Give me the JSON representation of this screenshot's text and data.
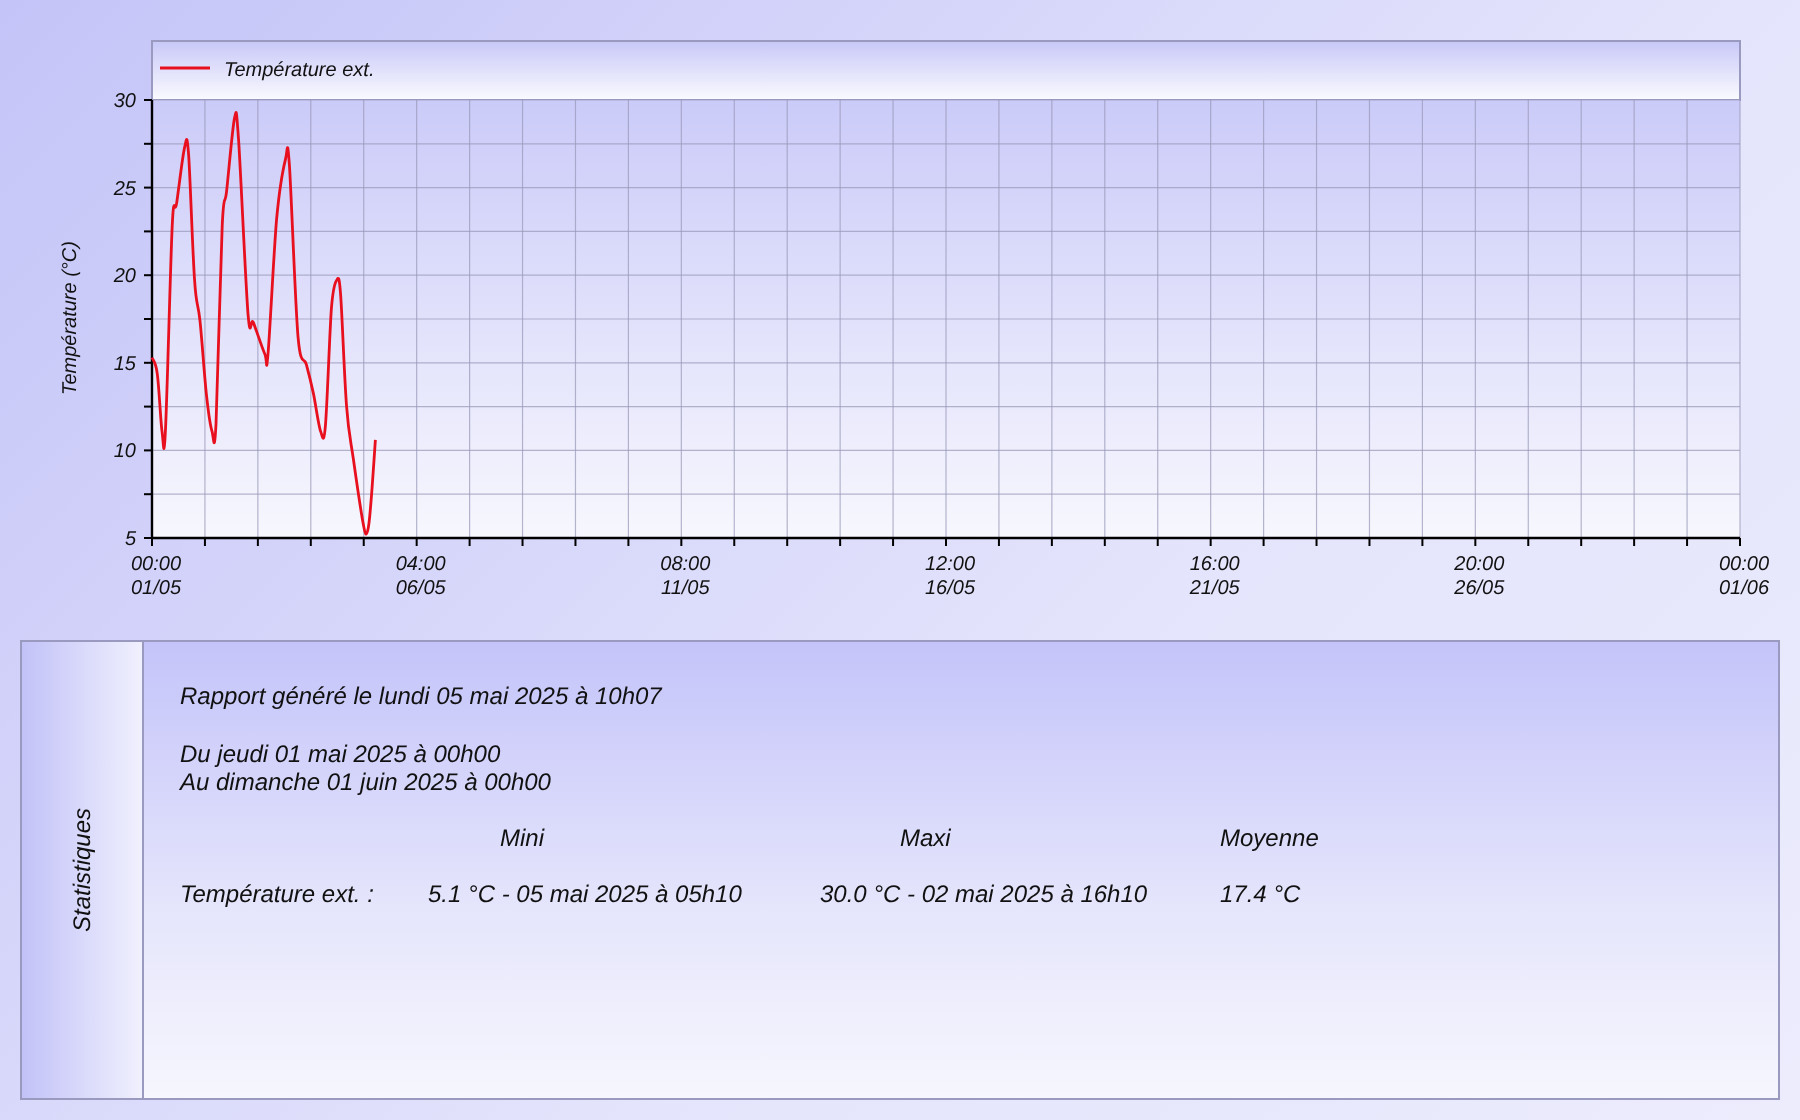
{
  "chart": {
    "chart_data": {
      "type": "line",
      "ylabel": "Température (°C)",
      "grid": true,
      "x": [
        0,
        0.08,
        0.151,
        0.204,
        0.305,
        0.372,
        0.492,
        0.552,
        0.643,
        0.725,
        0.823,
        0.907,
        0.967,
        1.061,
        1.128,
        1.248,
        1.308,
        1.452,
        1.531,
        1.704,
        1.752,
        1.884,
        2.016,
        2.076,
        2.208,
        2.335,
        2.441,
        2.549,
        2.621,
        2.712,
        2.791,
        2.851,
        2.94,
        3.043,
        3.197,
        3.257,
        3.305,
        3.377
      ],
      "series": [
        {
          "name": "Température ext.",
          "color": "#e8101e",
          "values": [
            15.3,
            14.4,
            11.1,
            11.1,
            22.8,
            24.1,
            27.3,
            26.9,
            19.7,
            17.4,
            13.2,
            11.1,
            11.5,
            22.8,
            24.8,
            29.0,
            27.7,
            17.8,
            17.3,
            15.5,
            15.5,
            23.2,
            26.6,
            26.3,
            16.5,
            14.9,
            13.2,
            11.1,
            11.4,
            18.1,
            19.7,
            18.9,
            12.5,
            9.5,
            5.7,
            5.4,
            6.8,
            10.6
          ]
        }
      ],
      "xlim": [
        0,
        24
      ],
      "ylim": [
        5,
        30
      ],
      "xticks": [
        {
          "value": 0,
          "label": "00:00"
        },
        {
          "value": 4,
          "label": "04:00"
        },
        {
          "value": 8,
          "label": "08:00"
        },
        {
          "value": 12,
          "label": "12:00"
        },
        {
          "value": 16,
          "label": "16:00"
        },
        {
          "value": 20,
          "label": "20:00"
        },
        {
          "value": 24,
          "label": "00:00"
        }
      ],
      "yticks": [
        5,
        10,
        15,
        20,
        25,
        30
      ]
    },
    "x_tick_dates": [
      "01/05",
      "06/05",
      "11/05",
      "16/05",
      "21/05",
      "26/05",
      "01/06"
    ]
  },
  "statistics": {
    "side_label": "Statistiques",
    "report_line": "Rapport généré le lundi 05 mai 2025 à 10h07",
    "period": [
      "Du jeudi 01 mai 2025 à 00h00",
      "Au dimanche 01 juin 2025 à 00h00"
    ],
    "columns": [
      "Mini",
      "Maxi",
      "Moyenne"
    ],
    "rows": [
      {
        "label": "Température ext. :",
        "cells": [
          "5.1 °C - 05 mai 2025 à 05h10",
          "30.0 °C - 02 mai 2025 à 16h10",
          "17.4 °C"
        ]
      }
    ]
  }
}
